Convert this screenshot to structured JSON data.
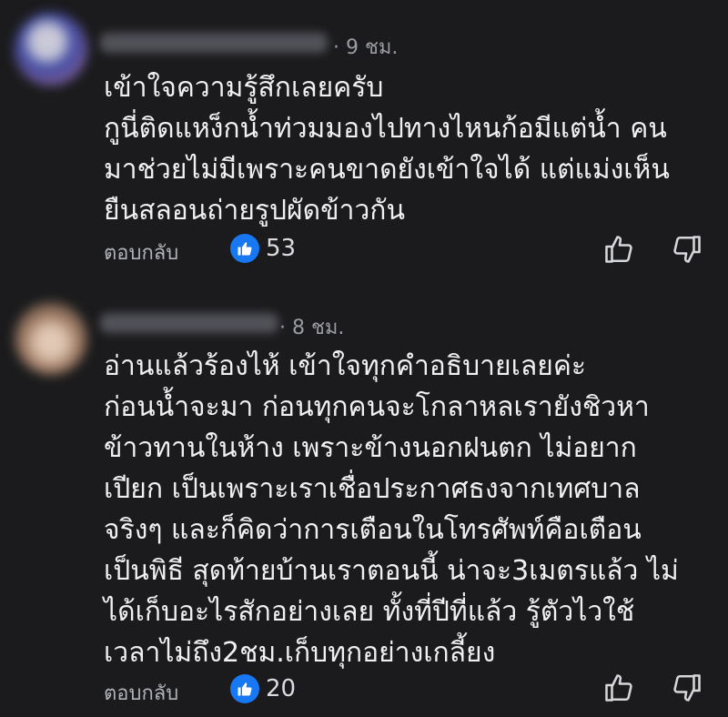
{
  "comments": [
    {
      "time": "· 9 ชม.",
      "lines": [
        "เข้าใจความรู้สึกเลยครับ",
        "กูนี่ติดแหง็กน้ำท่วมมองไปทางไหนก้อมีแต่น้ำ คน",
        "มาช่วยไม่มีเพราะคนขาดยังเข้าใจได้ แต่แม่งเห็น",
        "ยืนสลอนถ่ายรูปผัดข้าวกัน"
      ],
      "reply_label": "ตอบกลับ",
      "like_count": "53",
      "colors": {
        "like": "#1877f2"
      },
      "icons": {
        "reaction": "like-reaction-icon",
        "up": "thumbs-up-icon",
        "down": "thumbs-down-icon"
      }
    },
    {
      "time": "· 8 ชม.",
      "lines": [
        "อ่านแล้วร้องไห้ เข้าใจทุกคำอธิบายเลยค่ะ",
        "ก่อนน้ำจะมา ก่อนทุกคนจะโกลาหลเรายังชิวหา",
        "ข้าวทานในห้าง เพราะข้างนอกฝนตก ไม่อยาก",
        "เปียก เป็นเพราะเราเชื่อประกาศธงจากเทศบาล",
        "จริงๆ และก็คิดว่าการเตือนในโทรศัพท์คือเตือน",
        "เป็นพิธี สุดท้ายบ้านเราตอนนี้ น่าจะ3เมตรแล้ว ไม่",
        "ได้เก็บอะไรสักอย่างเลย ทั้งที่ปีที่แล้ว รู้ตัวไวใช้",
        "เวลาไม่ถึง2ชม.เก็บทุกอย่างเกลี้ยง"
      ],
      "reply_label": "ตอบกลับ",
      "like_count": "20",
      "colors": {
        "like": "#1877f2"
      },
      "icons": {
        "reaction": "like-reaction-icon",
        "up": "thumbs-up-icon",
        "down": "thumbs-down-icon"
      }
    }
  ]
}
